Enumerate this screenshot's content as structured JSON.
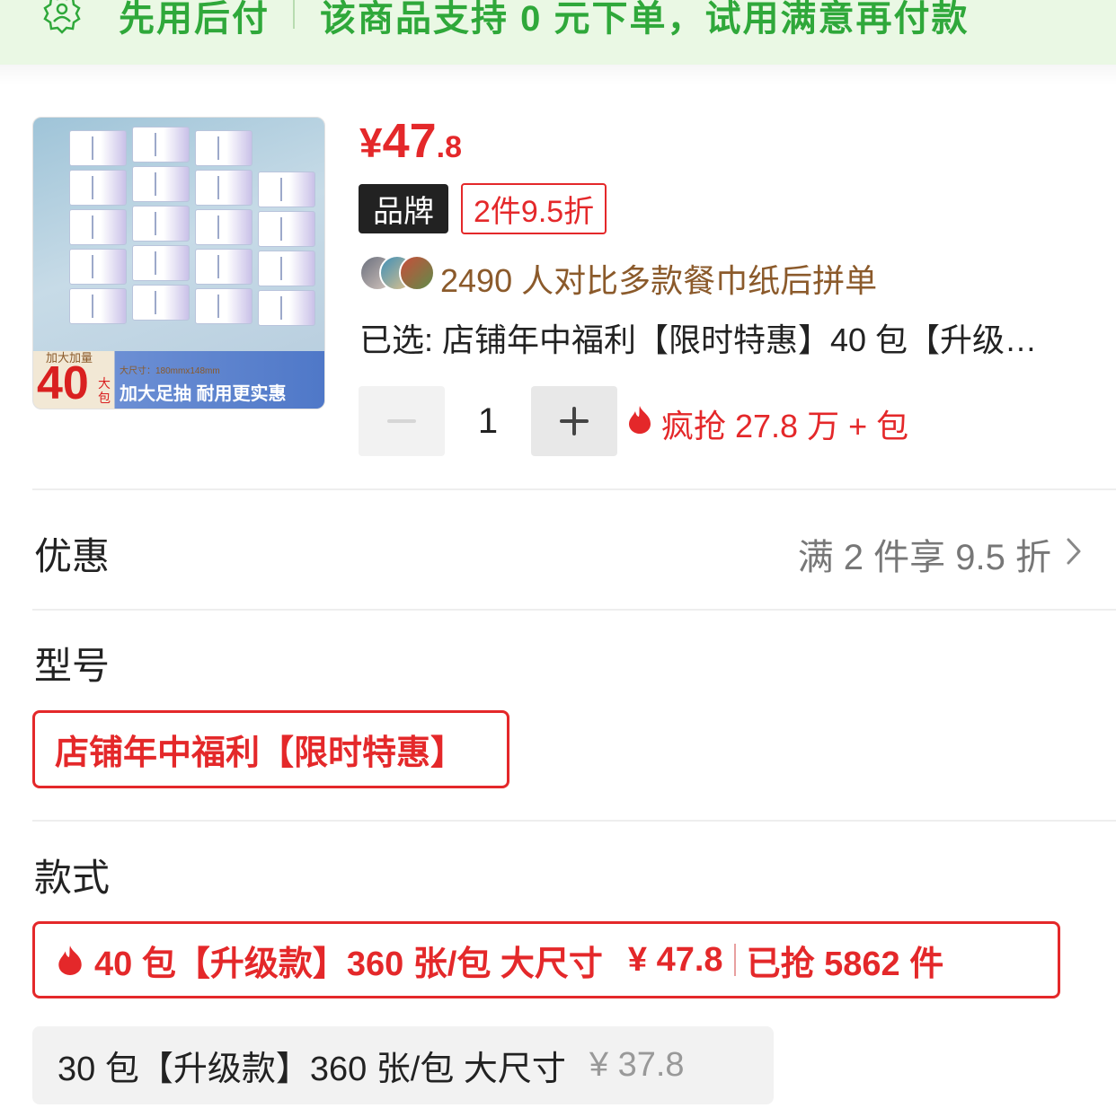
{
  "banner": {
    "title": "先用后付",
    "description": "该商品支持 0 元下单，试用满意再付款"
  },
  "product": {
    "image_tag": "加大加量",
    "image_count": "40",
    "image_unit": "大包",
    "image_size": "大尺寸：180mmx148mm",
    "image_slogan": "加大足抽 耐用更实惠",
    "price_symbol": "¥",
    "price_int": "47",
    "price_dec": ".8",
    "brand_badge": "品牌",
    "discount_badge": "2件9.5折",
    "compare_text": "2490 人对比多款餐巾纸后拼单",
    "selected_text": "已选: 店铺年中福利【限时特惠】40 包【升级…",
    "quantity": "1",
    "hot_text": "疯抢 27.8 万 + 包"
  },
  "promotion": {
    "label": "优惠",
    "value": "满 2 件享 9.5 折"
  },
  "model": {
    "label": "型号",
    "option": "店铺年中福利【限时特惠】"
  },
  "style": {
    "label": "款式",
    "options": [
      {
        "name": "40 包【升级款】360 张/包 大尺寸",
        "price": "¥ 47.8",
        "sold": "已抢 5862 件",
        "selected": true
      },
      {
        "name": "30 包【升级款】360 张/包 大尺寸",
        "price": "¥ 37.8",
        "selected": false
      }
    ]
  },
  "colors": {
    "accent_red": "#e4282a",
    "banner_green": "#2fa83a",
    "banner_bg": "#eaf8e4",
    "compare_brown": "#8b5a2b"
  },
  "icons": {
    "banner": "badge-check-icon",
    "hot": "fire-icon",
    "promo": "chevron-right-icon"
  }
}
